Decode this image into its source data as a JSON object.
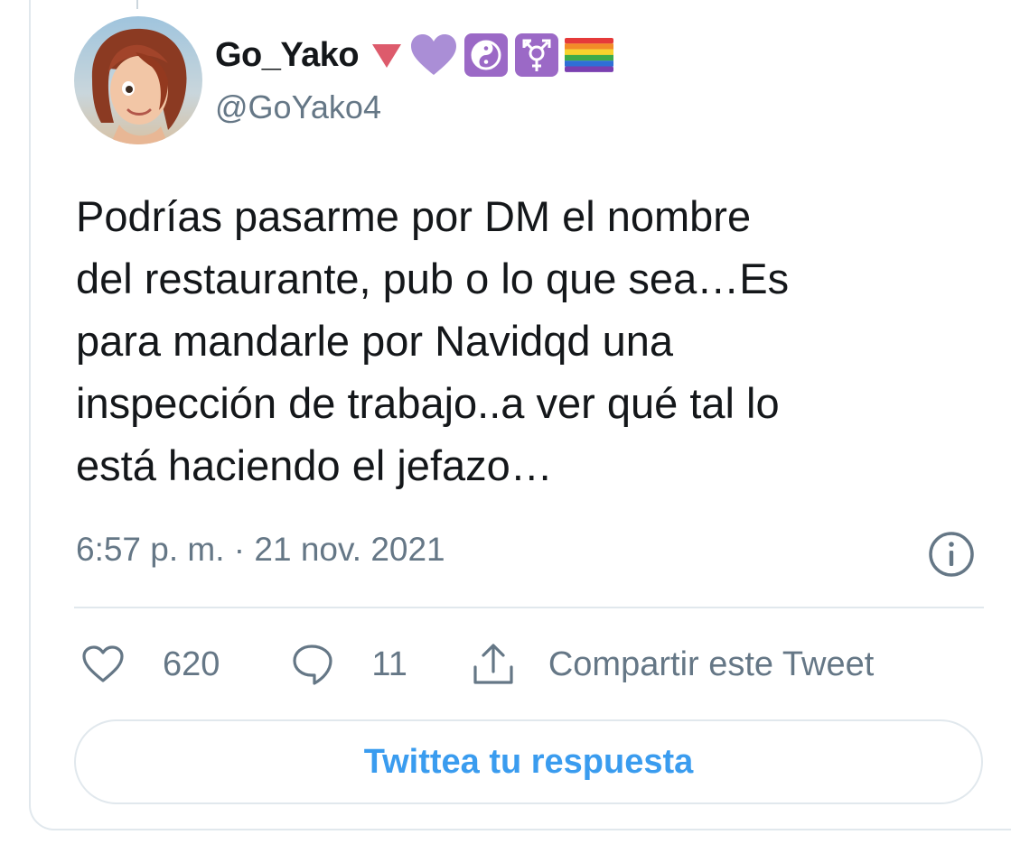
{
  "user": {
    "display_name": "Go_Yako",
    "handle": "@GoYako4",
    "name_emojis": [
      "red-down-triangle",
      "purple-heart",
      "yin-yang",
      "transgender-symbol",
      "rainbow-flag"
    ]
  },
  "tweet": {
    "text": "Podrías pasarme por DM el nombre\ndel restaurante, pub o lo que sea…Es\npara mandarle por Navidqd una\ninspección de trabajo..a ver qué tal lo\nestá haciendo el jefazo…",
    "timestamp": "6:57 p. m. · 21 nov. 2021"
  },
  "actions": {
    "likes_count": "620",
    "replies_count": "11",
    "share_label": "Compartir este Tweet"
  },
  "reply_box": {
    "label": "Twittea tu respuesta"
  },
  "colors": {
    "text_primary": "#14171a",
    "text_secondary": "#657786",
    "accent_blue": "#3a9cef",
    "border": "#e1e8ed"
  },
  "icons": {
    "info": "info-circle-icon",
    "like": "heart-icon",
    "reply": "speech-bubble-icon",
    "share": "share-upload-icon"
  }
}
